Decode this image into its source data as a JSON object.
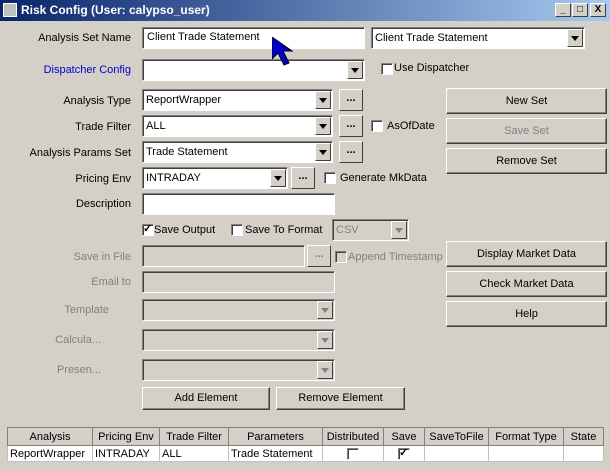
{
  "window": {
    "title": "Risk Config (User: calypso_user)",
    "buttons": [
      "_",
      "□",
      "X"
    ]
  },
  "form": {
    "analysis_set_name": {
      "label": "Analysis Set Name",
      "value": "Client Trade Statement",
      "combo": "Client Trade Statement"
    },
    "dispatcher_config": {
      "label": "Dispatcher Config",
      "value": "",
      "use_dispatcher": "Use Dispatcher"
    },
    "analysis_type": {
      "label": "Analysis Type",
      "value": "ReportWrapper"
    },
    "trade_filter": {
      "label": "Trade Filter",
      "value": "ALL",
      "asofdate": "AsOfDate"
    },
    "analysis_params_set": {
      "label": "Analysis Params Set",
      "value": "Trade Statement"
    },
    "pricing_env": {
      "label": "Pricing Env",
      "value": "INTRADAY",
      "generate_mkdata": "Generate MkData"
    },
    "description": {
      "label": "Description",
      "value": ""
    },
    "save_output": "Save Output",
    "save_to_format": "Save To Format",
    "format_value": "CSV",
    "save_in_file": {
      "label": "Save in File",
      "append": "Append Timestamp"
    },
    "email_to": {
      "label": "Email to"
    },
    "template": {
      "label": "Template"
    },
    "calcula": {
      "label": "Calcula..."
    },
    "presen": {
      "label": "Presen..."
    },
    "dots": "..."
  },
  "buttons": {
    "new_set": "New Set",
    "save_set": "Save Set",
    "remove_set": "Remove Set",
    "display_market_data": "Display Market Data",
    "check_market_data": "Check Market Data",
    "help": "Help",
    "add_element": "Add Element",
    "remove_element": "Remove Element"
  },
  "table": {
    "columns": [
      "Analysis",
      "Pricing Env",
      "Trade Filter",
      "Parameters",
      "Distributed",
      "Save",
      "SaveToFile",
      "Format Type",
      "State"
    ],
    "rows": [
      {
        "analysis": "ReportWrapper",
        "pricing_env": "INTRADAY",
        "trade_filter": "ALL",
        "parameters": "Trade Statement",
        "distributed": false,
        "save": true,
        "save_to_file": "",
        "format_type": "",
        "state": ""
      }
    ]
  },
  "colors": {
    "title_start": "#0a246a",
    "title_end": "#a6caf0",
    "face": "#d4d0c8",
    "cursor": "#0000cc"
  }
}
